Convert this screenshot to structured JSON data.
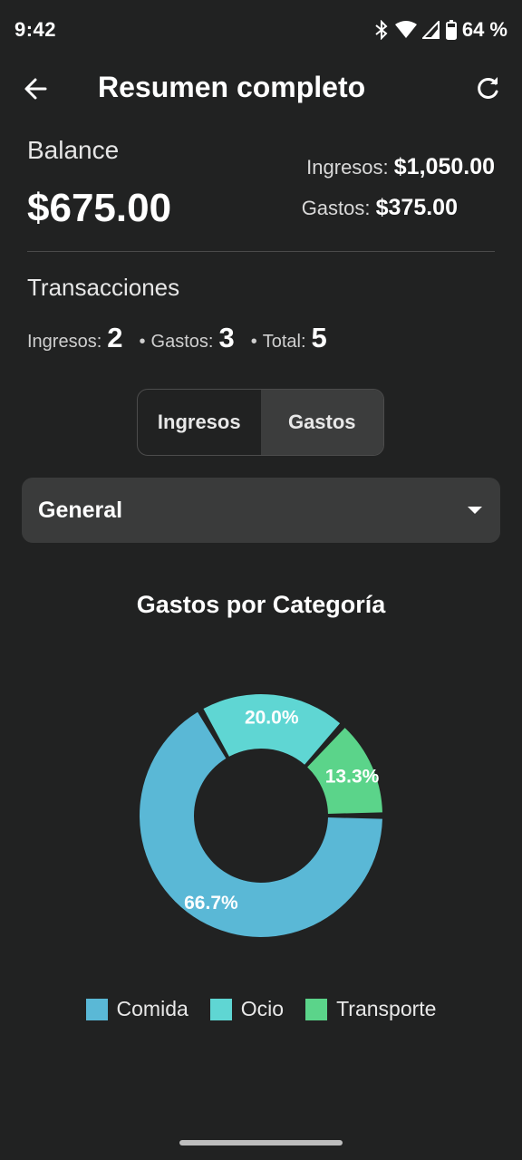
{
  "status_bar": {
    "time": "9:42",
    "battery": "64 %"
  },
  "app_bar": {
    "title": "Resumen completo"
  },
  "balance": {
    "label": "Balance",
    "value": "$675.00",
    "income_label": "Ingresos:",
    "income_value": "$1,050.00",
    "expense_label": "Gastos:",
    "expense_value": "$375.00"
  },
  "transactions": {
    "title": "Transacciones",
    "income_label": "Ingresos:",
    "income_count": "2",
    "expense_label": "Gastos:",
    "expense_count": "3",
    "total_label": "Total:",
    "total_count": "5"
  },
  "tabs": [
    {
      "label": "Ingresos",
      "active": false
    },
    {
      "label": "Gastos",
      "active": true
    }
  ],
  "filter": {
    "selected": "General"
  },
  "chart_data": {
    "type": "pie",
    "title": "Gastos por Categoría",
    "categories": [
      "Comida",
      "Ocio",
      "Transporte"
    ],
    "values": [
      66.7,
      20.0,
      13.3
    ],
    "labels": [
      "66.7%",
      "20.0%",
      "13.3%"
    ],
    "colors": [
      "#5ab8d6",
      "#5fd6d3",
      "#5bd48a"
    ],
    "legend_position": "bottom"
  }
}
